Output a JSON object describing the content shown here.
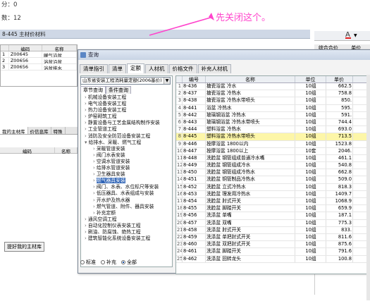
{
  "top_lines": [
    "分：0",
    "数：12"
  ],
  "annotation": "先关闭这个。",
  "back_window": {
    "title": "8-445 主材价材料",
    "headers": [
      "",
      "编码",
      "名称"
    ],
    "rows": [
      {
        "n": "1",
        "code": "Z00645",
        "name": "暖气沿盆"
      },
      {
        "n": "2",
        "code": "Z00656",
        "name": "浴盆沿盆"
      },
      {
        "n": "3",
        "code": "Z00656",
        "name": "浴盆排水"
      }
    ],
    "tabs": [
      "我的主材库",
      "价信息库",
      "特殊"
    ],
    "sub_headers": [
      "编码",
      "名称"
    ],
    "bottom_button": "提好我的主材库"
  },
  "right_bg": {
    "headers": [
      "综合合价",
      "单价"
    ]
  },
  "dialog": {
    "title": "查询",
    "tabs": [
      "清单指引",
      "清单",
      "定额",
      "人材机",
      "价格文件",
      "补充人材机"
    ],
    "active_tab": "定额",
    "dropdown": "山东省安装工程消耗量定额(2006基价)",
    "subtabs": [
      "章节查询",
      "条件查询"
    ],
    "tree": [
      "机械设备安装工程",
      "电气设备安装工程",
      "热力设备安装工程",
      "炉窑砌筑工程",
      "静置设备与工艺金属结构制作安装",
      "工业管道工程",
      "消防及安全防范设备安装工程",
      "给排水、采暖、燃气工程",
      "采暖管道安装",
      "阀门水表安装",
      "空调水管道安装",
      "给排水管道安装",
      "卫生器具安装",
      "燃气器具安装",
      "阀门、水表、水位标尺等安装",
      "低压器具、水表组成与安装",
      "开水炉及热水器",
      "燃气管道、附件、器具安装",
      "补充定额",
      "通风空调工程",
      "自动化控制仪表安装工程",
      "刷油、防腐蚀、绝热工程",
      "建筑智能化系统设备安装工程"
    ],
    "tree_selected": 13,
    "radios": [
      "标准",
      "补充",
      "全部"
    ],
    "radio_selected": 2,
    "table_headers": [
      "",
      "编号",
      "名称",
      "单位",
      "单价"
    ],
    "rows": [
      [
        "1",
        "8-436",
        "搪瓷浴盆 冷水",
        "10组",
        "662.5"
      ],
      [
        "2",
        "8-437",
        "搪瓷浴盆 冷热水",
        "10组",
        "758.8"
      ],
      [
        "3",
        "8-438",
        "搪瓷浴盆 冷热水带喷头",
        "10组",
        "850."
      ],
      [
        "4",
        "8-441",
        "浴盆 冷热水",
        "10组",
        "595."
      ],
      [
        "5",
        "8-442",
        "玻璃钢浴盆 冷热水",
        "10组",
        "591."
      ],
      [
        "6",
        "8-443",
        "玻璃钢浴盆 冷热水带喷头",
        "10组",
        "744.4"
      ],
      [
        "7",
        "8-444",
        "塑料浴盆 冷热水",
        "10组",
        "693.0"
      ],
      [
        "8",
        "8-445",
        "塑料浴盆 冷热水带喷头",
        "10组",
        "713.5"
      ],
      [
        "9",
        "8-446",
        "按摩浴盆 1800以内",
        "10组",
        "1523.8"
      ],
      [
        "10",
        "8-447",
        "按摩浴盆 1800以上",
        "10套",
        "2046."
      ],
      [
        "11",
        "8-448",
        "洗脸盆 钢管组成普通冷水嘴",
        "10组",
        "461.1"
      ],
      [
        "12",
        "8-449",
        "洗脸盆 钢管组成冷水",
        "10组",
        "540.8"
      ],
      [
        "13",
        "8-450",
        "洗脸盆 钢管组成冷热水",
        "10组",
        "662.8"
      ],
      [
        "14",
        "8-451",
        "洗脸盆 铜管制品冷热水",
        "10组",
        "509.0"
      ],
      [
        "15",
        "8-452",
        "洗脸盆 立式冷热水",
        "10组",
        "818.3"
      ],
      [
        "16",
        "8-453",
        "洗脸盆 理发用冷热水",
        "10组",
        "1409.7"
      ],
      [
        "17",
        "8-454",
        "洗脸盆 肘式开关",
        "10组",
        "1068.9"
      ],
      [
        "18",
        "8-455",
        "洗脸盆 脚踏开关",
        "10组",
        "659.9"
      ],
      [
        "19",
        "8-456",
        "洗涤盆 单嘴",
        "10组",
        "187.1"
      ],
      [
        "20",
        "8-457",
        "洗涤盆 双嘴",
        "10组",
        "775.3"
      ],
      [
        "21",
        "8-458",
        "洗涤盆 肘式开关",
        "10组",
        "833."
      ],
      [
        "22",
        "8-459",
        "洗涤盆 单把肘式开关",
        "10组",
        "811.6"
      ],
      [
        "23",
        "8-460",
        "洗涤盆 双把肘式开关",
        "10组",
        "875.6"
      ],
      [
        "24",
        "8-461",
        "洗涤盆 脚踏开关",
        "10组",
        "791.6"
      ],
      [
        "25",
        "8-462",
        "洗涤盆 回转龙头",
        "10组",
        "100.8"
      ]
    ],
    "selected_row": 7
  }
}
